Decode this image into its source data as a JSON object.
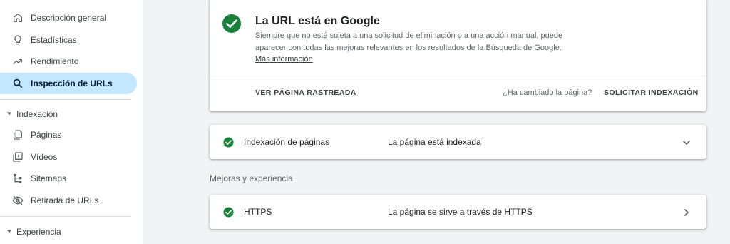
{
  "sidebar": {
    "items": [
      {
        "label": "Descripción general",
        "icon": "home-icon"
      },
      {
        "label": "Estadísticas",
        "icon": "lightbulb-icon"
      },
      {
        "label": "Rendimiento",
        "icon": "trending-up-icon"
      },
      {
        "label": "Inspección de URLs",
        "icon": "search-icon",
        "active": true
      }
    ],
    "sections": [
      {
        "label": "Indexación",
        "items": [
          {
            "label": "Páginas",
            "icon": "pages-icon"
          },
          {
            "label": "Vídeos",
            "icon": "video-icon"
          },
          {
            "label": "Sitemaps",
            "icon": "sitemap-icon"
          },
          {
            "label": "Retirada de URLs",
            "icon": "eye-off-icon"
          }
        ]
      },
      {
        "label": "Experiencia"
      }
    ]
  },
  "status_card": {
    "title": "La URL está en Google",
    "description": "Siempre que no esté sujeta a una solicitud de eliminación o a una acción manual, puede aparecer con todas las mejoras relevantes en los resultados de la Búsqueda de Google.",
    "link": "Más información",
    "crawled_button": "VER PÁGINA RASTREADA",
    "question": "¿Ha cambiado la página?",
    "request_button": "SOLICITAR INDEXACIÓN"
  },
  "indexing_row": {
    "label": "Indexación de páginas",
    "status": "La página está indexada"
  },
  "enhancements": {
    "title": "Mejoras y experiencia",
    "rows": [
      {
        "label": "HTTPS",
        "status": "La página se sirve a través de HTTPS"
      }
    ]
  },
  "colors": {
    "success": "#188038",
    "active_bg": "#c2e7ff"
  }
}
